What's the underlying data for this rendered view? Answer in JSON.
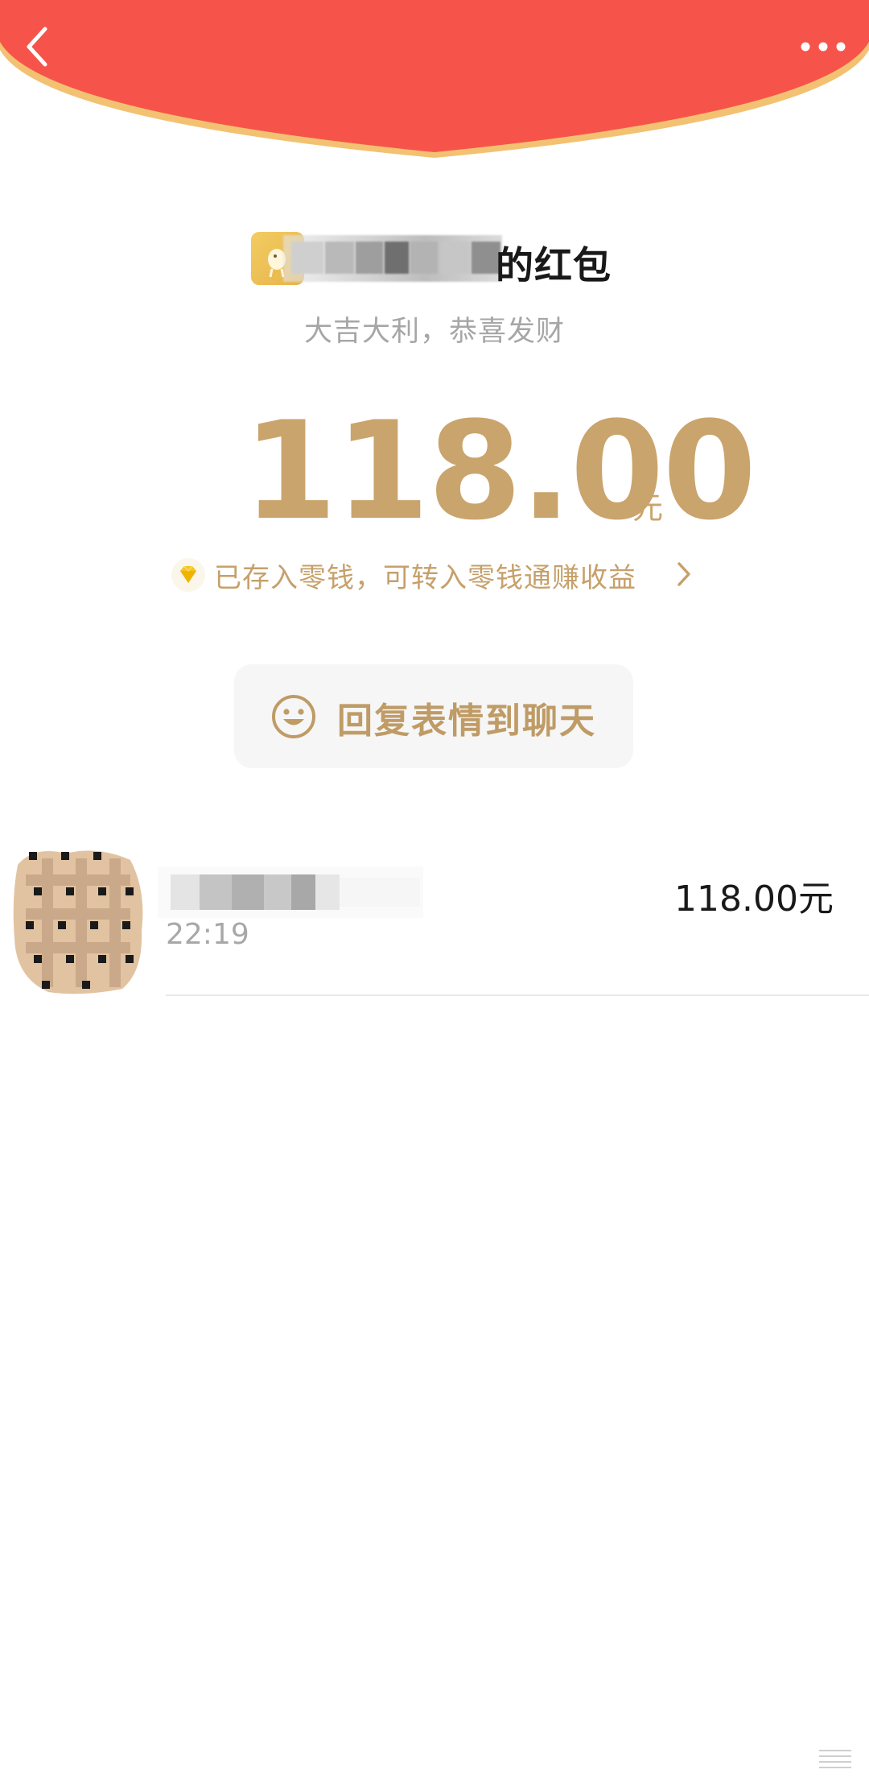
{
  "colors": {
    "header_red": "#f6544a",
    "header_edge": "#f3c172",
    "gold": "#c9a46c",
    "text_dark": "#191919",
    "text_gray": "#a6a6a6",
    "button_bg": "#f6f6f6"
  },
  "nav": {
    "back_icon": "chevron-left-icon",
    "more_icon": "more-dots-icon"
  },
  "envelope": {
    "sender_suffix": "的红包",
    "blessing": "大吉大利，恭喜发财",
    "amount": "118.00",
    "unit": "元",
    "stored_text": "已存入零钱，可转入零钱通赚收益",
    "stored_icon": "diamond-icon",
    "stored_chevron": "chevron-right-icon"
  },
  "reply": {
    "label": "回复表情到聊天",
    "icon": "smile-icon"
  },
  "record": {
    "time": "22:19",
    "amount": "118.00元"
  }
}
